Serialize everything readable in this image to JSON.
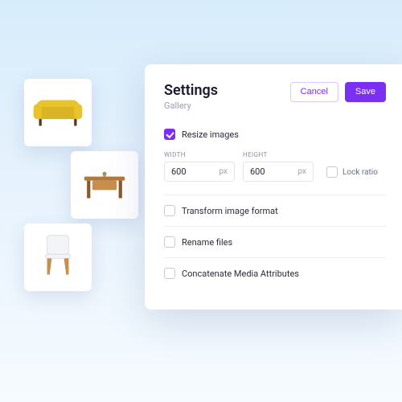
{
  "panel": {
    "title": "Settings",
    "subtitle": "Gallery",
    "cancel_label": "Cancel",
    "save_label": "Save"
  },
  "resize": {
    "checkbox_label": "Resize images",
    "checked": true,
    "width_label": "WIDTH",
    "width_value": "600",
    "height_label": "HEIGHT",
    "height_value": "600",
    "unit": "px",
    "lock_ratio_label": "Lock ratio",
    "lock_ratio_checked": false
  },
  "options": [
    {
      "label": "Transform image format",
      "checked": false
    },
    {
      "label": "Rename files",
      "checked": false
    },
    {
      "label": "Concatenate Media Attributes",
      "checked": false
    }
  ],
  "thumbnails": [
    {
      "name": "sofa",
      "icon": "sofa-icon"
    },
    {
      "name": "table",
      "icon": "table-icon"
    },
    {
      "name": "chair",
      "icon": "chair-icon"
    }
  ],
  "colors": {
    "accent": "#7b2ff2"
  }
}
